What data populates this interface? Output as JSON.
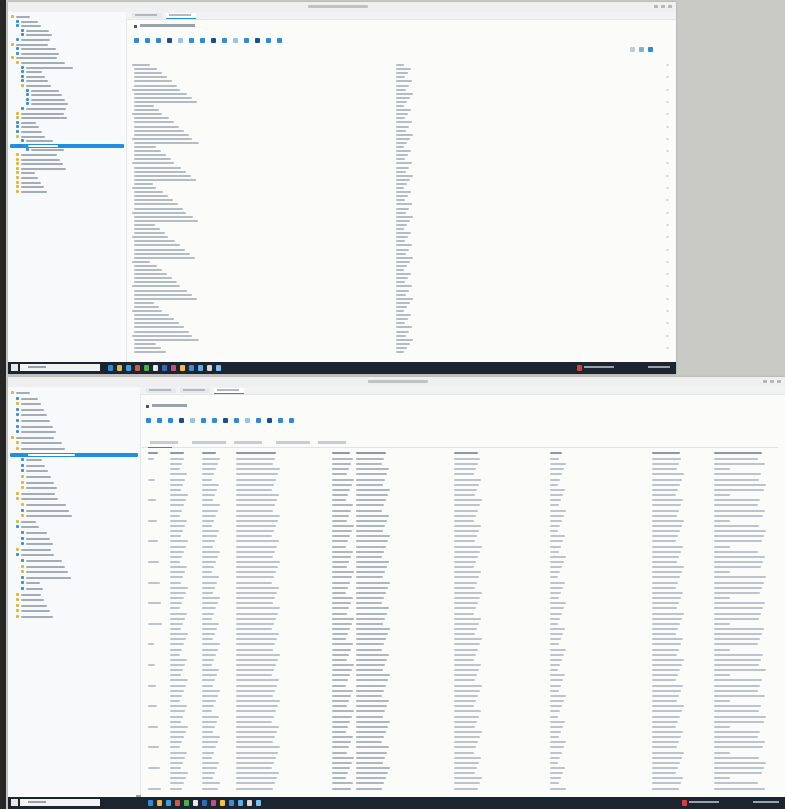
{
  "top_screen": {
    "window_title": "",
    "tabs": [
      {
        "label": "",
        "active": false
      },
      {
        "label": "",
        "active": true
      }
    ],
    "breadcrumb": "",
    "tree_items": [
      {
        "label": "",
        "depth": 0,
        "icon": "folder-icon",
        "selected": false
      },
      {
        "label": "",
        "depth": 1,
        "icon": "file-icon",
        "selected": false
      },
      {
        "label": "",
        "depth": 1,
        "icon": "file-icon",
        "selected": false
      },
      {
        "label": "",
        "depth": 2,
        "icon": "file-icon",
        "selected": false
      },
      {
        "label": "",
        "depth": 2,
        "icon": "file-icon",
        "selected": false
      },
      {
        "label": "",
        "depth": 1,
        "icon": "file-icon",
        "selected": false
      },
      {
        "label": "",
        "depth": 0,
        "icon": "folder-icon",
        "selected": false
      },
      {
        "label": "",
        "depth": 1,
        "icon": "file-icon",
        "selected": false
      },
      {
        "label": "",
        "depth": 1,
        "icon": "file-icon",
        "selected": false
      },
      {
        "label": "",
        "depth": 0,
        "icon": "folder-icon",
        "selected": false
      },
      {
        "label": "",
        "depth": 1,
        "icon": "folder-icon",
        "selected": false
      },
      {
        "label": "",
        "depth": 2,
        "icon": "file-icon",
        "selected": false
      },
      {
        "label": "",
        "depth": 2,
        "icon": "file-icon",
        "selected": false
      },
      {
        "label": "",
        "depth": 2,
        "icon": "file-icon",
        "selected": false
      },
      {
        "label": "",
        "depth": 2,
        "icon": "file-icon",
        "selected": false
      },
      {
        "label": "",
        "depth": 2,
        "icon": "folder-icon",
        "selected": false
      },
      {
        "label": "",
        "depth": 3,
        "icon": "file-icon",
        "selected": false
      },
      {
        "label": "",
        "depth": 3,
        "icon": "file-icon",
        "selected": false
      },
      {
        "label": "",
        "depth": 3,
        "icon": "file-icon",
        "selected": false
      },
      {
        "label": "",
        "depth": 3,
        "icon": "file-icon",
        "selected": false
      },
      {
        "label": "",
        "depth": 2,
        "icon": "file-icon",
        "selected": false
      },
      {
        "label": "",
        "depth": 1,
        "icon": "folder-icon",
        "selected": false
      },
      {
        "label": "",
        "depth": 1,
        "icon": "folder-icon",
        "selected": false
      },
      {
        "label": "",
        "depth": 1,
        "icon": "file-icon",
        "selected": false
      },
      {
        "label": "",
        "depth": 1,
        "icon": "file-icon",
        "selected": false
      },
      {
        "label": "",
        "depth": 1,
        "icon": "file-icon",
        "selected": false
      },
      {
        "label": "",
        "depth": 1,
        "icon": "folder-icon",
        "selected": false
      },
      {
        "label": "",
        "depth": 2,
        "icon": "file-icon",
        "selected": false
      },
      {
        "label": "",
        "depth": 2,
        "icon": "file-icon",
        "selected": true
      },
      {
        "label": "",
        "depth": 3,
        "icon": "file-icon",
        "selected": false
      },
      {
        "label": "",
        "depth": 1,
        "icon": "folder-icon",
        "selected": false
      },
      {
        "label": "",
        "depth": 1,
        "icon": "folder-icon",
        "selected": false
      },
      {
        "label": "",
        "depth": 1,
        "icon": "folder-icon",
        "selected": false
      },
      {
        "label": "",
        "depth": 1,
        "icon": "folder-icon",
        "selected": false
      },
      {
        "label": "",
        "depth": 1,
        "icon": "folder-icon",
        "selected": false
      },
      {
        "label": "",
        "depth": 1,
        "icon": "folder-icon",
        "selected": false
      },
      {
        "label": "",
        "depth": 1,
        "icon": "folder-icon",
        "selected": false
      },
      {
        "label": "",
        "depth": 1,
        "icon": "folder-icon",
        "selected": false
      },
      {
        "label": "",
        "depth": 1,
        "icon": "folder-icon",
        "selected": false
      }
    ],
    "toolbar_icons": [
      "edit-icon",
      "back-icon",
      "forward-icon",
      "info-icon",
      "checkbox-icon",
      "tree-icon",
      "copy-icon",
      "save-icon",
      "run-icon",
      "code-icon",
      "tag-icon",
      "link-icon",
      "lock-icon",
      "settings-icon"
    ],
    "properties": [
      {
        "name": "",
        "value": ""
      },
      {
        "name": "",
        "value": ""
      },
      {
        "name": "",
        "value": ""
      },
      {
        "name": "",
        "value": ""
      },
      {
        "name": "",
        "value": ""
      },
      {
        "name": "",
        "value": ""
      },
      {
        "name": "",
        "value": ""
      },
      {
        "name": "",
        "value": ""
      },
      {
        "name": "",
        "value": ""
      },
      {
        "name": "",
        "value": ""
      },
      {
        "name": "",
        "value": ""
      },
      {
        "name": "",
        "value": ""
      },
      {
        "name": "",
        "value": ""
      },
      {
        "name": "",
        "value": ""
      },
      {
        "name": "",
        "value": ""
      },
      {
        "name": "",
        "value": ""
      },
      {
        "name": "",
        "value": ""
      },
      {
        "name": "",
        "value": ""
      },
      {
        "name": "",
        "value": ""
      },
      {
        "name": "",
        "value": ""
      },
      {
        "name": "",
        "value": ""
      },
      {
        "name": "",
        "value": ""
      },
      {
        "name": "",
        "value": ""
      },
      {
        "name": "",
        "value": ""
      },
      {
        "name": "",
        "value": ""
      },
      {
        "name": "",
        "value": ""
      },
      {
        "name": "",
        "value": ""
      },
      {
        "name": "",
        "value": ""
      },
      {
        "name": "",
        "value": ""
      },
      {
        "name": "",
        "value": ""
      },
      {
        "name": "",
        "value": ""
      },
      {
        "name": "",
        "value": ""
      },
      {
        "name": "",
        "value": ""
      },
      {
        "name": "",
        "value": ""
      },
      {
        "name": "",
        "value": ""
      },
      {
        "name": "",
        "value": ""
      },
      {
        "name": "",
        "value": ""
      },
      {
        "name": "",
        "value": ""
      },
      {
        "name": "",
        "value": ""
      },
      {
        "name": "",
        "value": ""
      },
      {
        "name": "",
        "value": ""
      },
      {
        "name": "",
        "value": ""
      },
      {
        "name": "",
        "value": ""
      },
      {
        "name": "",
        "value": ""
      },
      {
        "name": "",
        "value": ""
      },
      {
        "name": "",
        "value": ""
      },
      {
        "name": "",
        "value": ""
      },
      {
        "name": "",
        "value": ""
      },
      {
        "name": "",
        "value": ""
      },
      {
        "name": "",
        "value": ""
      },
      {
        "name": "",
        "value": ""
      },
      {
        "name": "",
        "value": ""
      },
      {
        "name": "",
        "value": ""
      },
      {
        "name": "",
        "value": ""
      },
      {
        "name": "",
        "value": ""
      },
      {
        "name": "",
        "value": ""
      },
      {
        "name": "",
        "value": ""
      },
      {
        "name": "",
        "value": ""
      },
      {
        "name": "",
        "value": ""
      },
      {
        "name": "",
        "value": ""
      },
      {
        "name": "",
        "value": ""
      },
      {
        "name": "",
        "value": ""
      },
      {
        "name": "",
        "value": ""
      },
      {
        "name": "",
        "value": ""
      },
      {
        "name": "",
        "value": ""
      },
      {
        "name": "",
        "value": ""
      },
      {
        "name": "",
        "value": ""
      },
      {
        "name": "",
        "value": ""
      },
      {
        "name": "",
        "value": ""
      },
      {
        "name": "",
        "value": ""
      },
      {
        "name": "",
        "value": ""
      }
    ],
    "taskbar": {
      "search_placeholder": "",
      "apps": [
        "app-icon",
        "app-icon",
        "app-icon",
        "app-icon",
        "app-icon",
        "app-icon",
        "app-icon",
        "app-icon",
        "app-icon",
        "app-icon",
        "app-icon",
        "app-icon",
        "app-icon"
      ],
      "weather": "",
      "clock": ""
    }
  },
  "bottom_screen": {
    "window_title": "",
    "tabs": [
      {
        "label": "",
        "active": false
      },
      {
        "label": "",
        "active": false
      },
      {
        "label": "",
        "active": true
      }
    ],
    "breadcrumb": "",
    "subtabs": [
      {
        "label": ""
      },
      {
        "label": ""
      },
      {
        "label": ""
      },
      {
        "label": ""
      },
      {
        "label": ""
      }
    ],
    "tree_items": [
      {
        "label": "",
        "depth": 0,
        "icon": "folder-icon",
        "selected": false
      },
      {
        "label": "",
        "depth": 1,
        "icon": "file-icon",
        "selected": false
      },
      {
        "label": "",
        "depth": 1,
        "icon": "folder-icon",
        "selected": false
      },
      {
        "label": "",
        "depth": 1,
        "icon": "file-icon",
        "selected": false
      },
      {
        "label": "",
        "depth": 1,
        "icon": "file-icon",
        "selected": false
      },
      {
        "label": "",
        "depth": 1,
        "icon": "file-icon",
        "selected": false
      },
      {
        "label": "",
        "depth": 1,
        "icon": "file-icon",
        "selected": false
      },
      {
        "label": "",
        "depth": 1,
        "icon": "file-icon",
        "selected": false
      },
      {
        "label": "",
        "depth": 0,
        "icon": "folder-icon",
        "selected": false
      },
      {
        "label": "",
        "depth": 1,
        "icon": "folder-icon",
        "selected": false
      },
      {
        "label": "",
        "depth": 1,
        "icon": "folder-icon",
        "selected": false
      },
      {
        "label": "",
        "depth": 2,
        "icon": "file-icon",
        "selected": true
      },
      {
        "label": "",
        "depth": 2,
        "icon": "file-icon",
        "selected": false
      },
      {
        "label": "",
        "depth": 2,
        "icon": "file-icon",
        "selected": false
      },
      {
        "label": "",
        "depth": 2,
        "icon": "file-icon",
        "selected": false
      },
      {
        "label": "",
        "depth": 2,
        "icon": "folder-icon",
        "selected": false
      },
      {
        "label": "",
        "depth": 2,
        "icon": "folder-icon",
        "selected": false
      },
      {
        "label": "",
        "depth": 2,
        "icon": "folder-icon",
        "selected": false
      },
      {
        "label": "",
        "depth": 1,
        "icon": "folder-icon",
        "selected": false
      },
      {
        "label": "",
        "depth": 1,
        "icon": "folder-icon",
        "selected": false
      },
      {
        "label": "",
        "depth": 2,
        "icon": "folder-icon",
        "selected": false
      },
      {
        "label": "",
        "depth": 2,
        "icon": "file-icon",
        "selected": false
      },
      {
        "label": "",
        "depth": 2,
        "icon": "folder-icon",
        "selected": false
      },
      {
        "label": "",
        "depth": 1,
        "icon": "folder-icon",
        "selected": false
      },
      {
        "label": "",
        "depth": 1,
        "icon": "file-icon",
        "selected": false
      },
      {
        "label": "",
        "depth": 2,
        "icon": "file-icon",
        "selected": false
      },
      {
        "label": "",
        "depth": 2,
        "icon": "file-icon",
        "selected": false
      },
      {
        "label": "",
        "depth": 2,
        "icon": "file-icon",
        "selected": false
      },
      {
        "label": "",
        "depth": 1,
        "icon": "folder-icon",
        "selected": false
      },
      {
        "label": "",
        "depth": 1,
        "icon": "file-icon",
        "selected": false
      },
      {
        "label": "",
        "depth": 2,
        "icon": "file-icon",
        "selected": false
      },
      {
        "label": "",
        "depth": 2,
        "icon": "folder-icon",
        "selected": false
      },
      {
        "label": "",
        "depth": 2,
        "icon": "folder-icon",
        "selected": false
      },
      {
        "label": "",
        "depth": 2,
        "icon": "file-icon",
        "selected": false
      },
      {
        "label": "",
        "depth": 2,
        "icon": "file-icon",
        "selected": false
      },
      {
        "label": "",
        "depth": 2,
        "icon": "file-icon",
        "selected": false
      },
      {
        "label": "",
        "depth": 1,
        "icon": "folder-icon",
        "selected": false
      },
      {
        "label": "",
        "depth": 1,
        "icon": "folder-icon",
        "selected": false
      },
      {
        "label": "",
        "depth": 1,
        "icon": "folder-icon",
        "selected": false
      },
      {
        "label": "",
        "depth": 1,
        "icon": "folder-icon",
        "selected": false
      },
      {
        "label": "",
        "depth": 1,
        "icon": "folder-icon",
        "selected": false
      }
    ],
    "toolbar_icons": [
      "edit-icon",
      "back-icon",
      "forward-icon",
      "info-icon",
      "checkbox-icon",
      "tree-icon",
      "copy-icon",
      "save-icon",
      "run-icon",
      "code-icon",
      "tag-icon",
      "link-icon",
      "binoculars-icon",
      "settings-icon"
    ],
    "columns": [
      "",
      "",
      "",
      "",
      "",
      "",
      "",
      "",
      "",
      ""
    ],
    "row_count": 65,
    "taskbar": {
      "search_placeholder": "",
      "apps": [
        "app-icon",
        "app-icon",
        "app-icon",
        "app-icon",
        "app-icon",
        "app-icon",
        "app-icon",
        "app-icon",
        "app-icon",
        "app-icon",
        "app-icon",
        "app-icon",
        "app-icon"
      ],
      "weather": "",
      "clock": ""
    }
  },
  "colors": {
    "accent": "#1e90e2",
    "toolbar_icon": "#2f8bd6",
    "toolbar_icon_alt": "#1f4e8c",
    "taskbar": "#1c2430",
    "folder": "#e3b53a",
    "tree_node": "#3b8fd4"
  }
}
